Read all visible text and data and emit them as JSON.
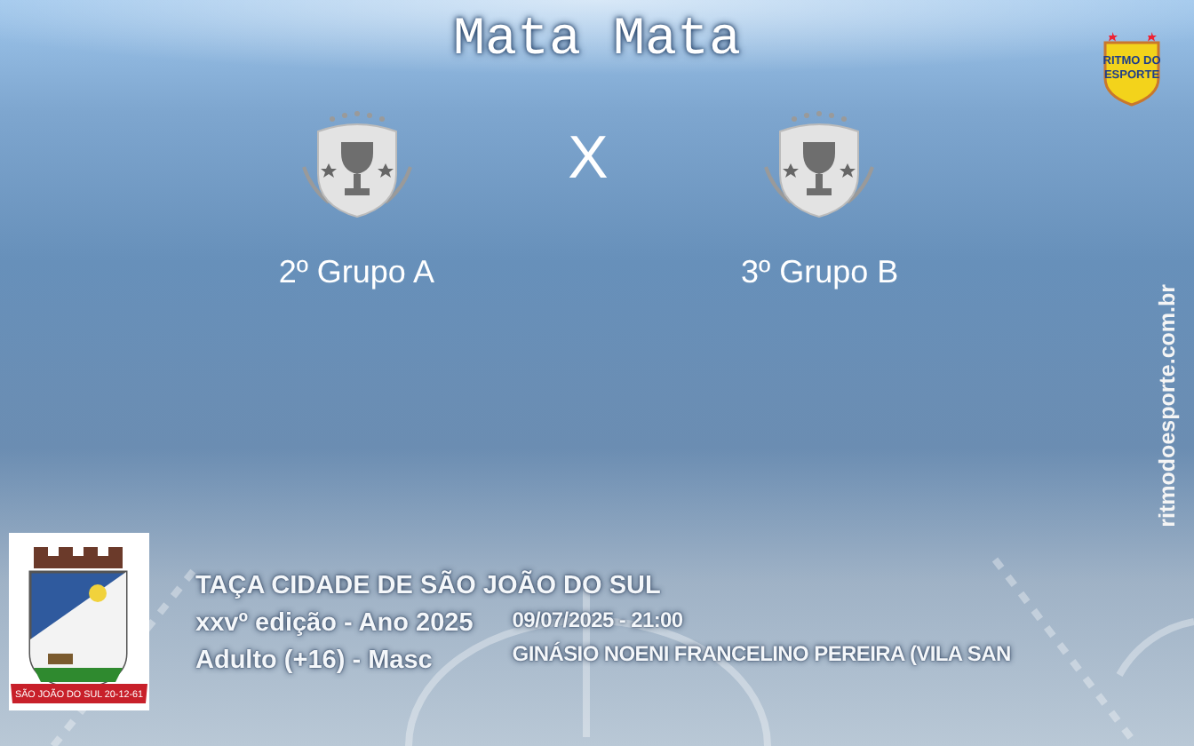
{
  "title": "Mata Mata",
  "teams": [
    {
      "name": "2º Grupo A"
    },
    {
      "name": "3º Grupo B"
    }
  ],
  "versus": "X",
  "logo": {
    "lines": [
      "RITMO DO",
      "ESPORTE"
    ]
  },
  "site": "ritmodoesporte.com.br",
  "event": {
    "competition": "TAÇA CIDADE DE SÃO JOÃO DO SUL",
    "edition": "xxvº edição - Ano 2025",
    "category": "Adulto (+16) - Masc",
    "datetime": "09/07/2025 - 21:00",
    "venue": "GINÁSIO NOENI FRANCELINO PEREIRA (VILA SAN",
    "crest_ribbon": "SÃO JOÃO DO SUL 20-12-61"
  }
}
